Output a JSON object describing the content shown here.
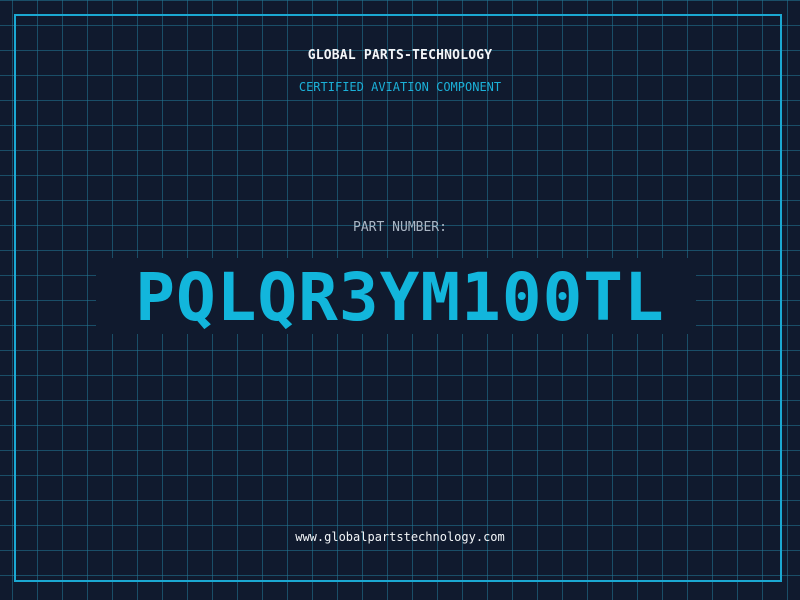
{
  "header": {
    "brand": "GLOBAL PARTS-TECHNOLOGY",
    "tagline": "CERTIFIED AVIATION COMPONENT"
  },
  "main": {
    "part_label": "PART NUMBER:",
    "part_number": "PQLQR3YM100TL"
  },
  "footer": {
    "website": "www.globalpartstechnology.com"
  },
  "colors": {
    "background": "#101a2e",
    "grid": "#227896",
    "accent": "#1ba8d2",
    "part_number": "#12b6dc",
    "text": "#f2f5f8",
    "muted": "#aab6c4"
  }
}
